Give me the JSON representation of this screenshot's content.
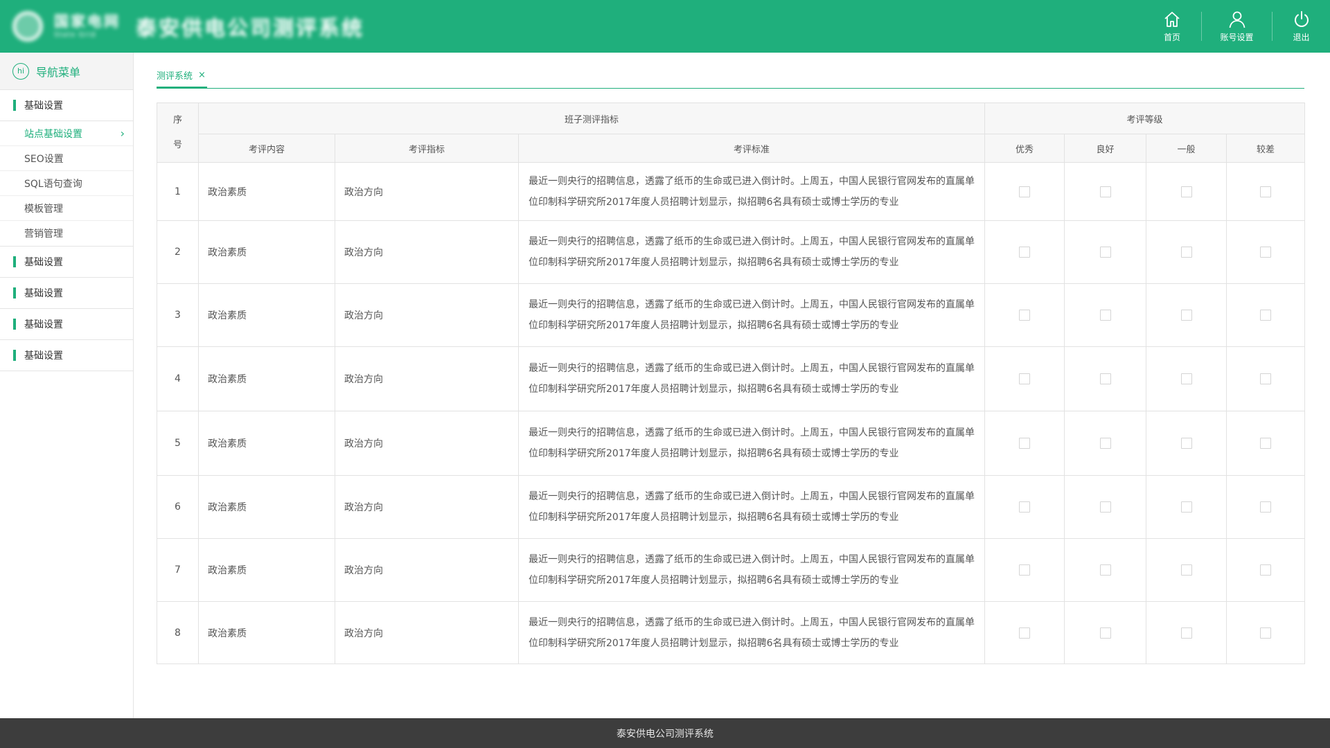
{
  "header": {
    "org_name": "国家电网",
    "org_name_en": "State Grid",
    "system_title": "泰安供电公司测评系统",
    "nav": [
      {
        "label": "首页",
        "icon": "home-icon"
      },
      {
        "label": "账号设置",
        "icon": "user-icon"
      },
      {
        "label": "退出",
        "icon": "power-icon"
      }
    ]
  },
  "sidebar": {
    "title": "导航菜单",
    "title_icon_text": "hi",
    "groups": [
      {
        "label": "基础设置"
      },
      {
        "label": "基础设置"
      },
      {
        "label": "基础设置"
      },
      {
        "label": "基础设置"
      },
      {
        "label": "基础设置"
      }
    ],
    "sub_items": [
      {
        "label": "站点基础设置",
        "active": true
      },
      {
        "label": "SEO设置"
      },
      {
        "label": "SQL语句查询"
      },
      {
        "label": "模板管理"
      },
      {
        "label": "营销管理"
      }
    ],
    "active_chevron": "›"
  },
  "tabs": [
    {
      "label": "测评系统",
      "close": "×"
    }
  ],
  "table": {
    "col_seq": "序号",
    "col_seq_top": "序",
    "col_seq_bottom": "号",
    "group_indicator": "班子测评指标",
    "group_level": "考评等级",
    "col_content": "考评内容",
    "col_indicator": "考评指标",
    "col_standard": "考评标准",
    "levels": [
      "优秀",
      "良好",
      "一般",
      "较差"
    ],
    "rows": [
      {
        "no": "1",
        "content": "政治素质",
        "indicator": "政治方向",
        "standard": "最近一则央行的招聘信息，透露了纸币的生命或已进入倒计时。上周五，中国人民银行官网发布的直属单位印制科学研究所2017年度人员招聘计划显示，拟招聘6名具有硕士或博士学历的专业"
      },
      {
        "no": "2",
        "content": "政治素质",
        "indicator": "政治方向",
        "standard": "最近一则央行的招聘信息，透露了纸币的生命或已进入倒计时。上周五，中国人民银行官网发布的直属单位印制科学研究所2017年度人员招聘计划显示，拟招聘6名具有硕士或博士学历的专业"
      },
      {
        "no": "3",
        "content": "政治素质",
        "indicator": "政治方向",
        "standard": "最近一则央行的招聘信息，透露了纸币的生命或已进入倒计时。上周五，中国人民银行官网发布的直属单位印制科学研究所2017年度人员招聘计划显示，拟招聘6名具有硕士或博士学历的专业"
      },
      {
        "no": "4",
        "content": "政治素质",
        "indicator": "政治方向",
        "standard": "最近一则央行的招聘信息，透露了纸币的生命或已进入倒计时。上周五，中国人民银行官网发布的直属单位印制科学研究所2017年度人员招聘计划显示，拟招聘6名具有硕士或博士学历的专业"
      },
      {
        "no": "5",
        "content": "政治素质",
        "indicator": "政治方向",
        "standard": "最近一则央行的招聘信息，透露了纸币的生命或已进入倒计时。上周五，中国人民银行官网发布的直属单位印制科学研究所2017年度人员招聘计划显示，拟招聘6名具有硕士或博士学历的专业"
      },
      {
        "no": "6",
        "content": "政治素质",
        "indicator": "政治方向",
        "standard": "最近一则央行的招聘信息，透露了纸币的生命或已进入倒计时。上周五，中国人民银行官网发布的直属单位印制科学研究所2017年度人员招聘计划显示，拟招聘6名具有硕士或博士学历的专业"
      },
      {
        "no": "7",
        "content": "政治素质",
        "indicator": "政治方向",
        "standard": "最近一则央行的招聘信息，透露了纸币的生命或已进入倒计时。上周五，中国人民银行官网发布的直属单位印制科学研究所2017年度人员招聘计划显示，拟招聘6名具有硕士或博士学历的专业"
      },
      {
        "no": "8",
        "content": "政治素质",
        "indicator": "政治方向",
        "standard": "最近一则央行的招聘信息，透露了纸币的生命或已进入倒计时。上周五，中国人民银行官网发布的直属单位印制科学研究所2017年度人员招聘计划显示，拟招聘6名具有硕士或博士学历的专业"
      }
    ]
  },
  "footer": {
    "text": "泰安供电公司测评系统"
  },
  "colors": {
    "brand": "#1faf7c",
    "footer_bg": "#3d3d3d",
    "header_cell_bg": "#f7f7f7"
  }
}
